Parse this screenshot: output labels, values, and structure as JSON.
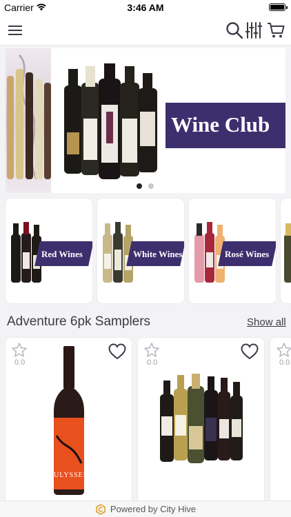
{
  "status_bar": {
    "carrier": "Carrier",
    "time": "3:46 AM"
  },
  "nav": {
    "menu_icon": "hamburger-menu-icon",
    "search_icon": "search-icon",
    "filter_icon": "filter-sliders-icon",
    "cart_icon": "cart-icon"
  },
  "hero": {
    "banner_text": "Wine Club",
    "slide_count": 2,
    "active_slide": 1
  },
  "categories": [
    {
      "label": "Red Wines"
    },
    {
      "label": "White Wines"
    },
    {
      "label": "Rosé Wines"
    }
  ],
  "section": {
    "title": "Adventure 6pk Samplers",
    "show_all": "Show all"
  },
  "products": [
    {
      "rating": "0.0",
      "label_text": "ULYSSES"
    },
    {
      "rating": "0.0"
    },
    {
      "rating": "0.0"
    }
  ],
  "footer": {
    "text": "Powered by City Hive",
    "logo_icon": "city-hive-logo-icon"
  },
  "colors": {
    "accent": "#3d2f6e",
    "nav_icon": "#3b3b46",
    "background": "#f3f3f5"
  }
}
